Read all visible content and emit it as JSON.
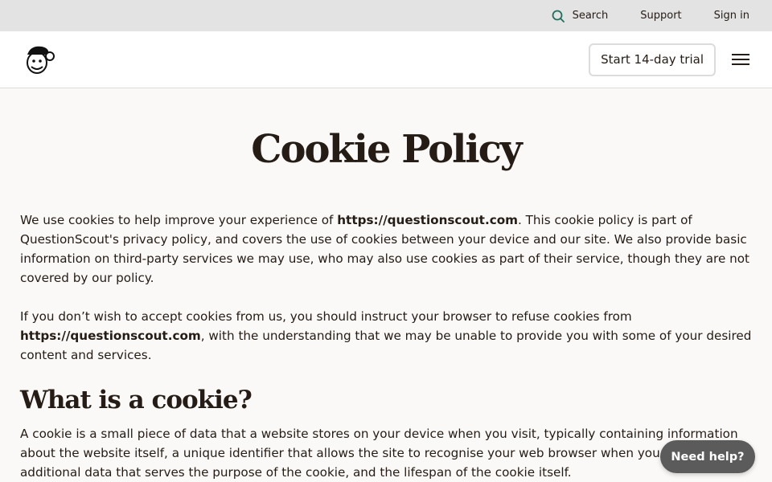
{
  "utility": {
    "search_label": "Search",
    "support_label": "Support",
    "signin_label": "Sign in"
  },
  "header": {
    "logo_icon": "freddie-monkey-logo-icon",
    "trial_label": "Start 14-day trial",
    "menu_icon": "hamburger-menu-icon"
  },
  "page": {
    "title": "Cookie Policy",
    "p1_a": "We use cookies to help improve your experience of ",
    "p1_link": "https://questionscout.com",
    "p1_b": ". This cookie policy is part of QuestionScout's privacy policy, and covers the use of cookies between your device and our site. We also provide basic information on third-party services we may use, who may also use cookies as part of their service, though they are not covered by our policy.",
    "p2_a": "If you don’t wish to accept cookies from us, you should instruct your browser to refuse cookies from ",
    "p2_link": "https://questionscout.com",
    "p2_b": ", with the understanding that we may be unable to provide you with some of your desired content and services.",
    "section1_title": "What is a cookie?",
    "p3": "A cookie is a small piece of data that a website stores on your device when you visit, typically containing information about the website itself, a unique identifier that allows the site to recognise your web browser when you return, additional data that serves the purpose of the cookie, and the lifespan of the cookie itself."
  },
  "help": {
    "label": "Need help?"
  }
}
